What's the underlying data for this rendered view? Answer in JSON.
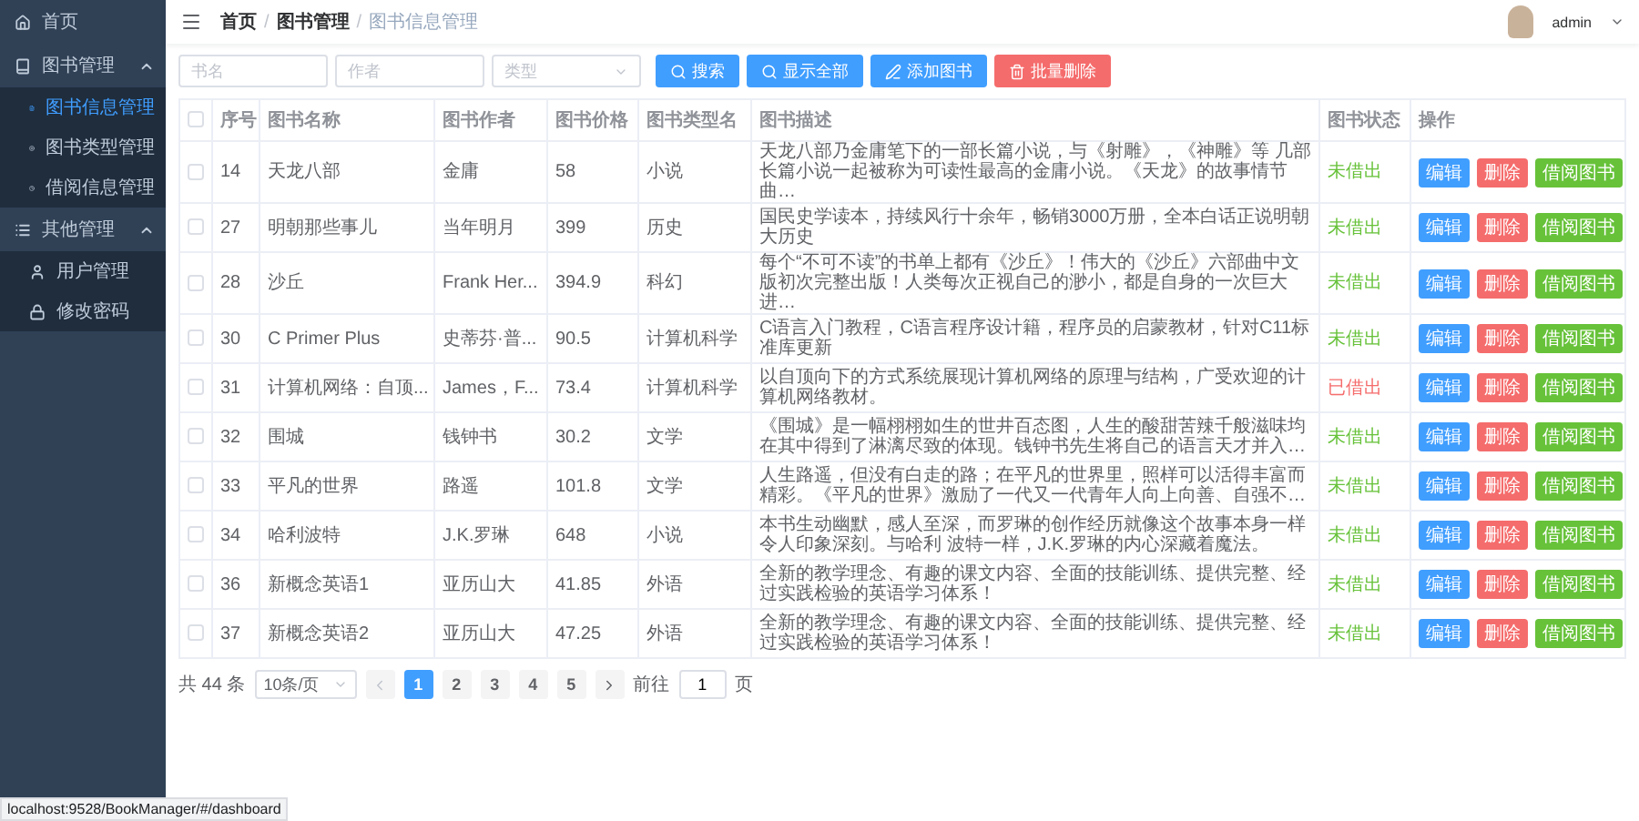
{
  "sidebar": {
    "items": [
      {
        "label": "首页",
        "kind": "link",
        "selected": false
      },
      {
        "label": "图书管理",
        "kind": "group",
        "expanded": true,
        "children": [
          {
            "label": "图书信息管理",
            "selected": true
          },
          {
            "label": "图书类型管理",
            "selected": false
          },
          {
            "label": "借阅信息管理",
            "selected": false
          }
        ]
      },
      {
        "label": "其他管理",
        "kind": "group",
        "expanded": true,
        "children": [
          {
            "label": "用户管理",
            "selected": false
          },
          {
            "label": "修改密码",
            "selected": false
          }
        ]
      }
    ]
  },
  "header": {
    "breadcrumb": [
      "首页",
      "图书管理",
      "图书信息管理"
    ],
    "separator": "/",
    "user": "admin"
  },
  "filters": {
    "fields": [
      {
        "placeholder": "书名",
        "kind": "text"
      },
      {
        "placeholder": "作者",
        "kind": "text"
      },
      {
        "placeholder": "类型",
        "kind": "select"
      }
    ],
    "buttons": [
      {
        "label": "搜索",
        "kind": "search"
      },
      {
        "label": "显示全部",
        "kind": "search"
      },
      {
        "label": "添加图书",
        "kind": "add"
      },
      {
        "label": "批量删除",
        "kind": "delete"
      }
    ]
  },
  "table": {
    "select_all_checked": false,
    "columns": [
      "序号",
      "图书名称",
      "图书作者",
      "图书价格",
      "图书类型名",
      "图书描述",
      "图书状态",
      "操作"
    ],
    "rows": [
      {
        "checked": false,
        "id": "14",
        "name": "天龙八部",
        "author": "金庸",
        "price": "58",
        "type": "小说",
        "description": "天龙八部乃金庸笔下的一部长篇小说，与《射雕》，《神雕》等 几部长篇小说一起被称为可读性最高的金庸小说。《天龙》的故事情节曲…",
        "status": "未借出",
        "borrowed": false,
        "actions": [
          {
            "label": "编辑",
            "kind": "edit"
          },
          {
            "label": "删除",
            "kind": "delete"
          },
          {
            "label": "借阅图书",
            "kind": "borrow"
          }
        ]
      },
      {
        "checked": false,
        "id": "27",
        "name": "明朝那些事儿",
        "author": "当年明月",
        "price": "399",
        "type": "历史",
        "description": "国民史学读本，持续风行十余年，畅销3000万册，全本白话正说明朝大历史",
        "status": "未借出",
        "borrowed": false,
        "actions": [
          {
            "label": "编辑",
            "kind": "edit"
          },
          {
            "label": "删除",
            "kind": "delete"
          },
          {
            "label": "借阅图书",
            "kind": "borrow"
          }
        ]
      },
      {
        "checked": false,
        "id": "28",
        "name": "沙丘",
        "author": "Frank Her...",
        "price": "394.9",
        "type": "科幻",
        "description": "每个“不可不读”的书单上都有《沙丘》！伟大的《沙丘》六部曲中文版初次完整出版！人类每次正视自己的渺小，都是自身的一次巨大进…",
        "status": "未借出",
        "borrowed": false,
        "actions": [
          {
            "label": "编辑",
            "kind": "edit"
          },
          {
            "label": "删除",
            "kind": "delete"
          },
          {
            "label": "借阅图书",
            "kind": "borrow"
          }
        ]
      },
      {
        "checked": false,
        "id": "30",
        "name": "C Primer Plus",
        "author": "史蒂芬·普...",
        "price": "90.5",
        "type": "计算机科学",
        "description": "C语言入门教程，C语言程序设计籍，程序员的启蒙教材，针对C11标准库更新",
        "status": "未借出",
        "borrowed": false,
        "actions": [
          {
            "label": "编辑",
            "kind": "edit"
          },
          {
            "label": "删除",
            "kind": "delete"
          },
          {
            "label": "借阅图书",
            "kind": "borrow"
          }
        ]
      },
      {
        "checked": false,
        "id": "31",
        "name": "计算机网络：自顶...",
        "author": "James，F...",
        "price": "73.4",
        "type": "计算机科学",
        "description": "以自顶向下的方式系统展现计算机网络的原理与结构，广受欢迎的计算机网络教材。",
        "status": "已借出",
        "borrowed": true,
        "actions": [
          {
            "label": "编辑",
            "kind": "edit"
          },
          {
            "label": "删除",
            "kind": "delete"
          },
          {
            "label": "借阅图书",
            "kind": "borrow"
          }
        ]
      },
      {
        "checked": false,
        "id": "32",
        "name": "围城",
        "author": "钱钟书",
        "price": "30.2",
        "type": "文学",
        "description": "《围城》是一幅栩栩如生的世井百态图，人生的酸甜苦辣千般滋味均在其中得到了淋漓尽致的体现。钱钟书先生将自己的语言天才并入…",
        "status": "未借出",
        "borrowed": false,
        "actions": [
          {
            "label": "编辑",
            "kind": "edit"
          },
          {
            "label": "删除",
            "kind": "delete"
          },
          {
            "label": "借阅图书",
            "kind": "borrow"
          }
        ]
      },
      {
        "checked": false,
        "id": "33",
        "name": "平凡的世界",
        "author": "路遥",
        "price": "101.8",
        "type": "文学",
        "description": "人生路遥，但没有白走的路；在平凡的世界里，照样可以活得丰富而精彩。《平凡的世界》激励了一代又一代青年人向上向善、自强不…",
        "status": "未借出",
        "borrowed": false,
        "actions": [
          {
            "label": "编辑",
            "kind": "edit"
          },
          {
            "label": "删除",
            "kind": "delete"
          },
          {
            "label": "借阅图书",
            "kind": "borrow"
          }
        ]
      },
      {
        "checked": false,
        "id": "34",
        "name": "哈利波特",
        "author": "J.K.罗琳",
        "price": "648",
        "type": "小说",
        "description": "本书生动幽默，感人至深，而罗琳的创作经历就像这个故事本身一样令人印象深刻。与哈利 波特一样，J.K.罗琳的内心深藏着魔法。",
        "status": "未借出",
        "borrowed": false,
        "actions": [
          {
            "label": "编辑",
            "kind": "edit"
          },
          {
            "label": "删除",
            "kind": "delete"
          },
          {
            "label": "借阅图书",
            "kind": "borrow"
          }
        ]
      },
      {
        "checked": false,
        "id": "36",
        "name": "新概念英语1",
        "author": "亚历山大",
        "price": "41.85",
        "type": "外语",
        "description": "全新的教学理念、有趣的课文内容、全面的技能训练、提供完整、经过实践检验的英语学习体系！",
        "status": "未借出",
        "borrowed": false,
        "actions": [
          {
            "label": "编辑",
            "kind": "edit"
          },
          {
            "label": "删除",
            "kind": "delete"
          },
          {
            "label": "借阅图书",
            "kind": "borrow"
          }
        ]
      },
      {
        "checked": false,
        "id": "37",
        "name": "新概念英语2",
        "author": "亚历山大",
        "price": "47.25",
        "type": "外语",
        "description": "全新的教学理念、有趣的课文内容、全面的技能训练、提供完整、经过实践检验的英语学习体系！",
        "status": "未借出",
        "borrowed": false,
        "actions": [
          {
            "label": "编辑",
            "kind": "edit"
          },
          {
            "label": "删除",
            "kind": "delete"
          },
          {
            "label": "借阅图书",
            "kind": "borrow"
          }
        ]
      }
    ]
  },
  "pagination": {
    "total": "共 44 条",
    "page_size": "10条/页",
    "pages": [
      {
        "label": "1",
        "selected": true
      },
      {
        "label": "2",
        "selected": false
      },
      {
        "label": "3",
        "selected": false
      },
      {
        "label": "4",
        "selected": false
      },
      {
        "label": "5",
        "selected": false
      }
    ],
    "goto_label": "前往",
    "goto_value": "1",
    "goto_suffix": "页"
  },
  "status_bar": "localhost:9528/BookManager/#/dashboard"
}
